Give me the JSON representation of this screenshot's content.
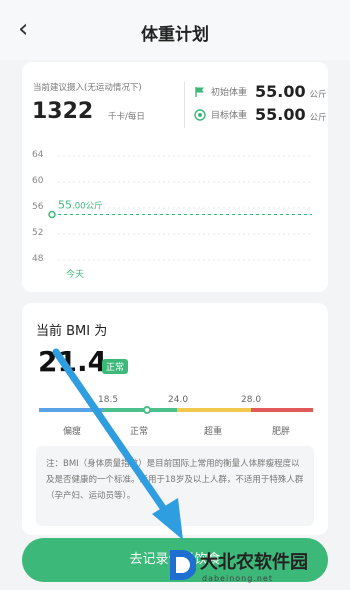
{
  "header": {
    "back_icon": "chevron-left-icon",
    "title": "体重计划"
  },
  "plan": {
    "intake_label": "当前建议摄入(无运动情况下)",
    "intake_value": "1322",
    "intake_unit": "千卡/每日",
    "initial_label": "初始体重",
    "initial_value": "55.00",
    "target_label": "目标体重",
    "target_value": "55.00",
    "weight_unit": "公斤"
  },
  "chart": {
    "y_ticks": [
      "64",
      "60",
      "56",
      "52",
      "48"
    ],
    "point_label_value": "55",
    "point_label_rest": ".00公斤",
    "today_label": "今天"
  },
  "chart_data": {
    "type": "line",
    "x": [
      "今天"
    ],
    "series": [
      {
        "values": [
          55.0
        ]
      }
    ],
    "ylim": [
      48,
      64
    ],
    "yticks": [
      64,
      60,
      56,
      52,
      48
    ],
    "grid": true
  },
  "bmi": {
    "title": "当前 BMI 为",
    "value": "21.4",
    "badge": "正常",
    "thresholds": [
      "18.5",
      "24.0",
      "28.0"
    ],
    "categories": [
      "偏瘦",
      "正常",
      "超重",
      "肥胖"
    ],
    "note": "注：BMI（身体质量指数）是目前国际上常用的衡量人体胖瘦程度以及是否健康的一个标准。适用于18岁及以上人群，不适用于特殊人群（孕产妇、运动员等）。",
    "colors": {
      "underweight": "#5aa3e6",
      "normal": "#4cc08a",
      "overweight": "#f2c94c",
      "obese": "#e05a5a"
    }
  },
  "action": {
    "button_label": "去记录今日饮食"
  },
  "watermark": {
    "text": "大北农软件园",
    "url": "dabeinong.net"
  },
  "accent": "#3cb879"
}
